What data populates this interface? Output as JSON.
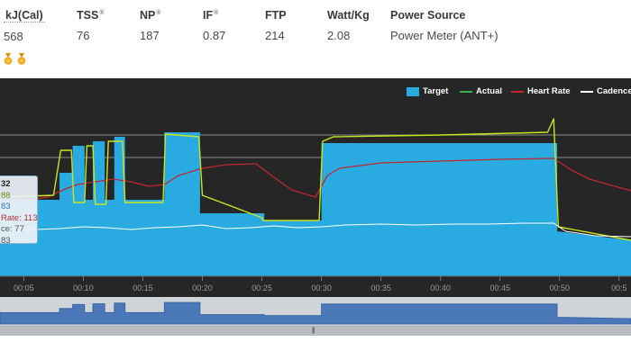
{
  "stats": [
    {
      "label": "kJ(Cal)",
      "value": "568"
    },
    {
      "label": "TSS",
      "value": "76",
      "mark": "®"
    },
    {
      "label": "NP",
      "value": "187",
      "mark": "®"
    },
    {
      "label": "IF",
      "value": "0.87",
      "mark": "®"
    },
    {
      "label": "FTP",
      "value": "214"
    },
    {
      "label": "Watt/Kg",
      "value": "2.08"
    },
    {
      "label": "Power Source",
      "value": "Power Meter (ANT+)"
    }
  ],
  "medals": {
    "count": 2,
    "icon": "medal-icon",
    "color": "#f2a81d"
  },
  "tooltip": {
    "time": "32",
    "actual": "88",
    "target": "83",
    "heart_rate": "Rate: 113",
    "cadence": "ce: 77",
    "extra": "83"
  },
  "colors": {
    "background": "#262626",
    "target": "#29abe2",
    "actual": "#c8e61e",
    "actual_legend": "#3cb64b",
    "heart_rate": "#c1272d",
    "cadence": "#ffffff",
    "navigator": "#4a78b8"
  },
  "chart_data": {
    "type": "area",
    "legend": {
      "placement": "top-right",
      "entries": [
        "Target",
        "Actual",
        "Heart Rate",
        "Cadence"
      ]
    },
    "x_tick_labels": [
      "00:05",
      "00:10",
      "00:15",
      "00:20",
      "00:25",
      "00:30",
      "00:35",
      "00:40",
      "00:45",
      "00:50",
      "00:5"
    ],
    "x_unit": "minutes",
    "xlim": [
      3.0,
      56.0
    ],
    "gridlines_y": [
      100,
      130
    ],
    "series": [
      {
        "name": "Target",
        "kind": "area",
        "points": [
          [
            3.0,
            85
          ],
          [
            8.0,
            85
          ],
          [
            8.0,
            115
          ],
          [
            9.1,
            115
          ],
          [
            9.1,
            145
          ],
          [
            10.1,
            145
          ],
          [
            10.1,
            85
          ],
          [
            10.8,
            85
          ],
          [
            10.8,
            150
          ],
          [
            11.8,
            150
          ],
          [
            11.8,
            85
          ],
          [
            12.6,
            85
          ],
          [
            12.6,
            155
          ],
          [
            13.5,
            155
          ],
          [
            13.5,
            85
          ],
          [
            16.8,
            85
          ],
          [
            16.8,
            160
          ],
          [
            19.8,
            160
          ],
          [
            19.8,
            70
          ],
          [
            25.2,
            70
          ],
          [
            25.2,
            62
          ],
          [
            30.0,
            62
          ],
          [
            30.0,
            148
          ],
          [
            49.8,
            148
          ],
          [
            49.8,
            50
          ],
          [
            56.0,
            40
          ]
        ]
      },
      {
        "name": "Actual",
        "kind": "line",
        "points": [
          [
            3.0,
            88
          ],
          [
            7.5,
            90
          ],
          [
            8.1,
            140
          ],
          [
            9.0,
            140
          ],
          [
            9.2,
            82
          ],
          [
            10.1,
            82
          ],
          [
            10.3,
            145
          ],
          [
            10.8,
            145
          ],
          [
            11.0,
            80
          ],
          [
            11.9,
            80
          ],
          [
            12.1,
            150
          ],
          [
            13.3,
            150
          ],
          [
            13.5,
            82
          ],
          [
            16.7,
            82
          ],
          [
            16.9,
            158
          ],
          [
            19.7,
            155
          ],
          [
            20.0,
            90
          ],
          [
            25.0,
            65
          ],
          [
            25.1,
            62
          ],
          [
            29.8,
            62
          ],
          [
            30.1,
            150
          ],
          [
            31.0,
            155
          ],
          [
            40.0,
            157
          ],
          [
            49.0,
            160
          ],
          [
            49.5,
            175
          ],
          [
            49.9,
            55
          ],
          [
            56.0,
            40
          ]
        ]
      },
      {
        "name": "Heart Rate",
        "kind": "line",
        "points": [
          [
            3.0,
            80
          ],
          [
            7.0,
            88
          ],
          [
            8.5,
            97
          ],
          [
            9.5,
            102
          ],
          [
            11.0,
            105
          ],
          [
            12.5,
            108
          ],
          [
            14.0,
            105
          ],
          [
            15.5,
            100
          ],
          [
            16.8,
            102
          ],
          [
            18.0,
            112
          ],
          [
            20.0,
            120
          ],
          [
            22.0,
            124
          ],
          [
            24.5,
            125
          ],
          [
            25.8,
            112
          ],
          [
            27.5,
            96
          ],
          [
            29.5,
            88
          ],
          [
            30.5,
            112
          ],
          [
            31.5,
            120
          ],
          [
            35.0,
            126
          ],
          [
            40.0,
            128
          ],
          [
            45.0,
            130
          ],
          [
            49.5,
            131
          ],
          [
            51.0,
            118
          ],
          [
            52.5,
            108
          ],
          [
            56.0,
            95
          ]
        ]
      },
      {
        "name": "Cadence",
        "kind": "line",
        "points": [
          [
            3.0,
            50
          ],
          [
            6.0,
            52
          ],
          [
            8.0,
            53
          ],
          [
            10.0,
            55
          ],
          [
            12.0,
            54
          ],
          [
            14.0,
            52
          ],
          [
            16.0,
            54
          ],
          [
            18.0,
            55
          ],
          [
            20.0,
            57
          ],
          [
            22.0,
            53
          ],
          [
            24.0,
            54
          ],
          [
            26.0,
            56
          ],
          [
            28.0,
            54
          ],
          [
            30.0,
            55
          ],
          [
            32.0,
            57
          ],
          [
            35.0,
            58
          ],
          [
            38.0,
            57
          ],
          [
            41.0,
            58
          ],
          [
            44.0,
            58
          ],
          [
            47.0,
            59
          ],
          [
            49.5,
            59
          ],
          [
            50.5,
            50
          ],
          [
            53.0,
            45
          ],
          [
            56.0,
            44
          ]
        ]
      }
    ]
  }
}
